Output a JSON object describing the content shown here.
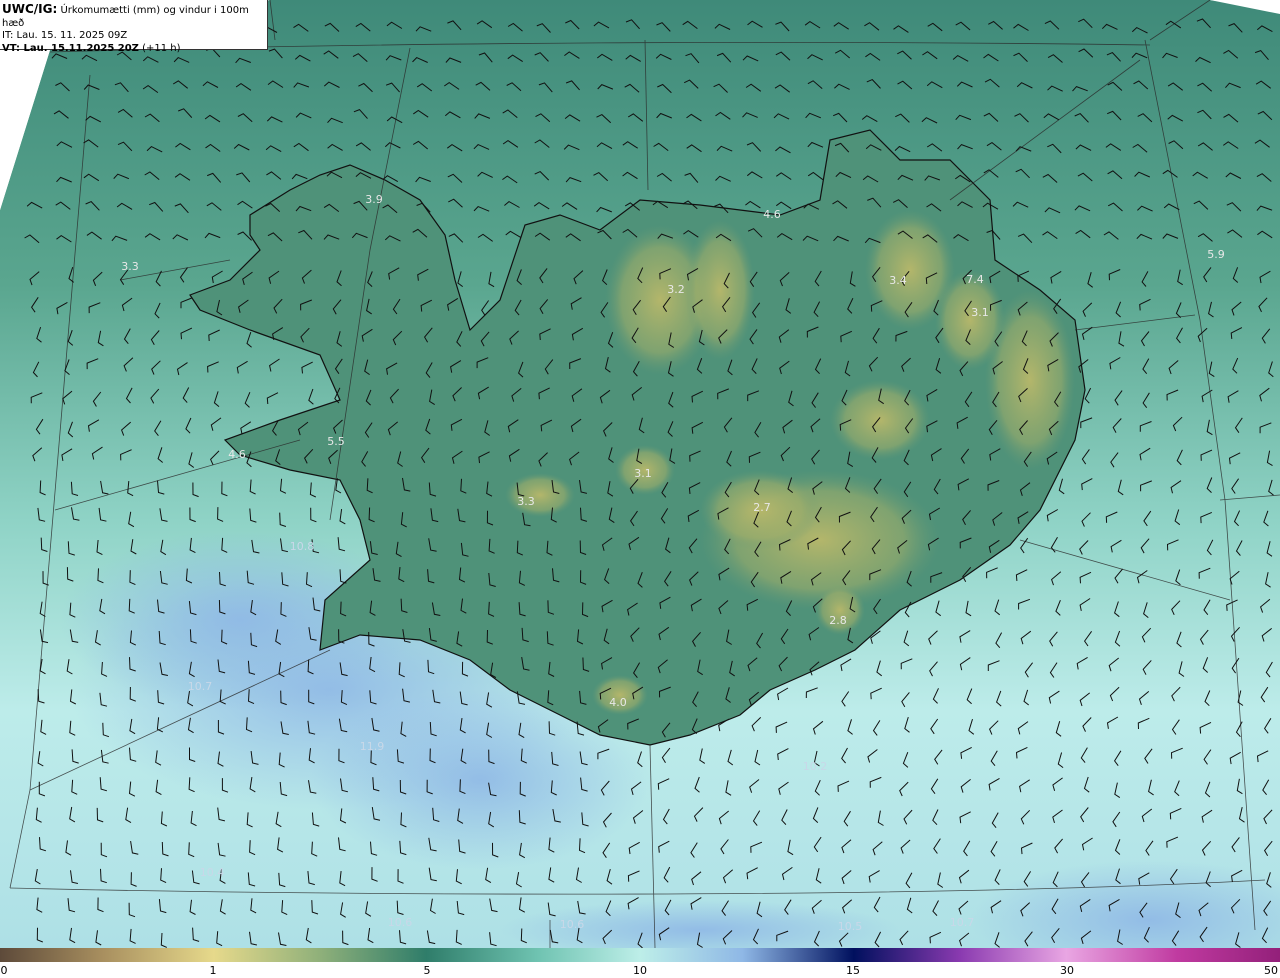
{
  "header": {
    "model": "UWC/IG:",
    "description": "Úrkomumætti (mm) og vindur i 100m hæð",
    "init_time": "IT: Lau. 15. 11. 2025 09Z",
    "valid_label": "VT: Lau. 15.11.2025 20Z",
    "valid_offset": "(+11 h)"
  },
  "colorbar": {
    "ticks": [
      "0",
      "1",
      "5",
      "10",
      "15",
      "30",
      "50"
    ],
    "colors": [
      "#5d4a3a",
      "#c9b46a",
      "#e9e08f",
      "#6aa37c",
      "#2f7d6a",
      "#b9eee8",
      "#9fc3e8",
      "#3a55b8",
      "#00105e",
      "#7f2aa8",
      "#e9a6e3",
      "#c03aa0",
      "#93207a"
    ]
  },
  "map_labels": [
    {
      "text": "3.9"
    },
    {
      "text": "3.3"
    },
    {
      "text": "3.2"
    },
    {
      "text": "4.6"
    },
    {
      "text": "3.4"
    },
    {
      "text": "7.4"
    },
    {
      "text": "3.1"
    },
    {
      "text": "5.9"
    },
    {
      "text": "4.6"
    },
    {
      "text": "5.5"
    },
    {
      "text": "3.3"
    },
    {
      "text": "3.1"
    },
    {
      "text": "2.7"
    },
    {
      "text": "10.8"
    },
    {
      "text": "2.8"
    },
    {
      "text": "10.7"
    },
    {
      "text": "4.0"
    },
    {
      "text": "11.9"
    },
    {
      "text": "10.2"
    },
    {
      "text": "10.4"
    },
    {
      "text": "10.6"
    },
    {
      "text": "10.6"
    },
    {
      "text": "10.5"
    },
    {
      "text": "10.7"
    }
  ],
  "colors": {
    "ocean_green": "#4f9a86",
    "ocean_light": "#b9ece4",
    "ocean_blue": "#9ec6ea",
    "land_green": "#4f8f73",
    "land_yellow": "#b7b86c",
    "coast": "#111111"
  }
}
